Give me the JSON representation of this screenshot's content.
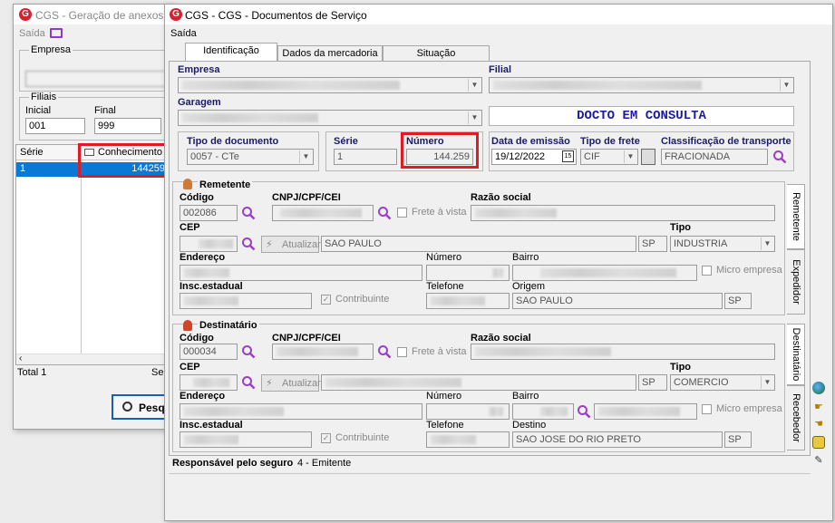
{
  "back_window": {
    "title": "CGS - Geração de anexos",
    "menu_saida": "Saída",
    "empresa_label": "Empresa",
    "filiais_label": "Filiais",
    "inicial_label": "Inicial",
    "final_label": "Final",
    "inicial_value": "001",
    "final_value": "999",
    "grid_headers": [
      "Série",
      "Conhecimento"
    ],
    "row": {
      "serie": "1",
      "conhecimento": "144259"
    },
    "total_label": "Total 1",
    "sel_label": "Sel",
    "pesquisar_label": "Pesqu"
  },
  "main_window": {
    "title": "CGS - CGS - Documentos de Serviço",
    "menu_saida": "Saída",
    "tabs": [
      "Identificação",
      "Dados da mercadoria",
      "Situação"
    ],
    "empresa_label": "Empresa",
    "filial_label": "Filial",
    "garagem_label": "Garagem",
    "status_text": "DOCTO EM CONSULTA",
    "tipo_doc_label": "Tipo de documento",
    "tipo_doc_value": "0057 - CTe",
    "serie_label": "Série",
    "serie_value": "1",
    "numero_label": "Número",
    "numero_value": "144.259",
    "data_emissao_label": "Data de emissão",
    "data_emissao_value": "19/12/2022",
    "tipo_frete_label": "Tipo de frete",
    "tipo_frete_value": "CIF",
    "classif_label": "Classificação de transporte",
    "classif_value": "FRACIONADA",
    "remetente": {
      "title": "Remetente",
      "codigo_label": "Código",
      "codigo_value": "002086",
      "cnpj_label": "CNPJ/CPF/CEI",
      "frete_vista": "Frete à vista",
      "razao_label": "Razão social",
      "cep_label": "CEP",
      "atualizar": "Atualizar",
      "cidade_value": "SAO PAULO",
      "uf_value": "SP",
      "tipo_label": "Tipo",
      "tipo_value": "INDUSTRIA",
      "endereco_label": "Endereço",
      "numero_label": "Número",
      "bairro_label": "Bairro",
      "micro_empresa": "Micro empresa",
      "insc_label": "Insc.estadual",
      "contribuinte": "Contribuinte",
      "telefone_label": "Telefone",
      "origem_label": "Origem",
      "origem_value": "SAO PAULO",
      "origem_uf": "SP"
    },
    "destinatario": {
      "title": "Destinatário",
      "codigo_label": "Código",
      "codigo_value": "000034",
      "cnpj_label": "CNPJ/CPF/CEI",
      "frete_vista": "Frete à vista",
      "razao_label": "Razão social",
      "cep_label": "CEP",
      "atualizar": "Atualizar",
      "uf_value": "SP",
      "tipo_label": "Tipo",
      "tipo_value": "COMERCIO",
      "endereco_label": "Endereço",
      "numero_label": "Número",
      "bairro_label": "Bairro",
      "micro_empresa": "Micro empresa",
      "insc_label": "Insc.estadual",
      "contribuinte": "Contribuinte",
      "telefone_label": "Telefone",
      "destino_label": "Destino",
      "destino_value": "SAO JOSE DO RIO PRETO",
      "destino_uf": "SP"
    },
    "side_tabs_top": [
      "Remetente",
      "Expedidor"
    ],
    "side_tabs_bottom": [
      "Destinatário",
      "Recebedor"
    ],
    "responsavel_label": "Responsável pelo seguro",
    "responsavel_value": "4 - Emitente"
  },
  "colors": {
    "accent_red": "#e01b24",
    "selection_blue": "#0a78d7",
    "status_text": "#1a1aa6",
    "logo_red": "#d8212f"
  }
}
